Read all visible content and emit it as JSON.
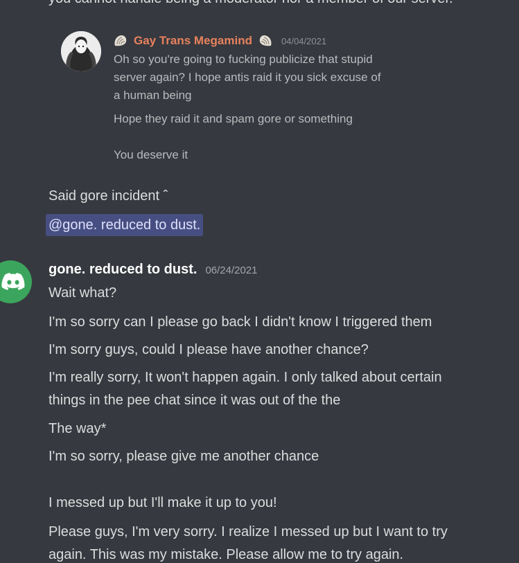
{
  "top_text": "you cannot handle being a moderator nor a member of our server.",
  "quote": {
    "author": "Gay Trans Megamind",
    "timestamp": "04/04/2021",
    "lines": [
      "Oh so you're going to fucking publicize that stupid",
      "server again? I hope antis raid it you sick excuse of",
      "a human being",
      "Hope they raid it and spam gore or something",
      "You deserve it"
    ],
    "icon_left": "seashell-icon",
    "icon_right": "seashell-icon"
  },
  "followup": {
    "text": "Said gore incident ˆ",
    "mention": "@gone. reduced to dust."
  },
  "message": {
    "author": "gone. reduced to dust.",
    "timestamp": "06/24/2021",
    "avatar_icon": "discord-logo-icon",
    "lines": [
      "Wait what?",
      "I'm so sorry can I please go back I didn't know I triggered them",
      "I'm sorry guys, could I please have another chance?",
      "I'm really sorry, It won't happen again. I only talked about certain",
      "things in the pee chat since it was out of the the",
      "The way*",
      "I'm so sorry, please give me another chance",
      "I messed up but I'll make it up to you!",
      "Please guys, I'm very sorry. I realize I messed up but I want to try",
      "again. This was my mistake. Please allow me to try again."
    ]
  },
  "colors": {
    "background": "#36393f",
    "quote_author": "#e8825d",
    "mention_bg": "#474f82",
    "avatar_green": "#3ba55d"
  }
}
